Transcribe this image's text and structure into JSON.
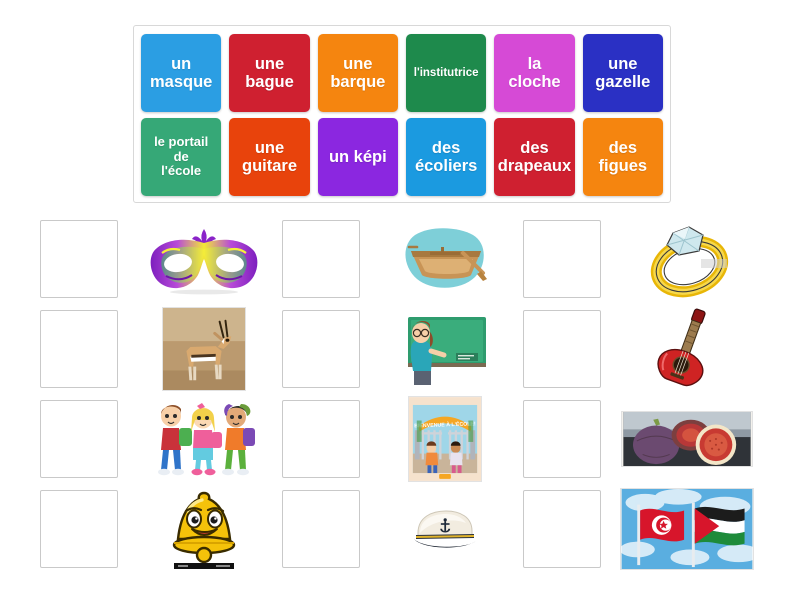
{
  "activity": {
    "type": "match-up drag and drop",
    "language": "French"
  },
  "tile_bank": {
    "rows": [
      [
        {
          "label": "un\nmasque",
          "color": "#2b9ee3",
          "size": "normal"
        },
        {
          "label": "une\nbague",
          "color": "#cf2030",
          "size": "normal"
        },
        {
          "label": "une\nbarque",
          "color": "#f5850f",
          "size": "normal"
        },
        {
          "label": "l'institutrice",
          "color": "#1e8a4c",
          "size": "small"
        },
        {
          "label": "la\ncloche",
          "color": "#d64ad6",
          "size": "normal"
        },
        {
          "label": "une\ngazelle",
          "color": "#2a30c4",
          "size": "normal"
        }
      ],
      [
        {
          "label": "le portail\nde\nl'école",
          "color": "#36a877",
          "size": "xsmall"
        },
        {
          "label": "une\nguitare",
          "color": "#e8430c",
          "size": "normal"
        },
        {
          "label": "un képi",
          "color": "#8b27e0",
          "size": "normal"
        },
        {
          "label": "des\nécoliers",
          "color": "#1b9ae0",
          "size": "normal"
        },
        {
          "label": "des\ndrapeaux",
          "color": "#cf2030",
          "size": "normal"
        },
        {
          "label": "des\nfigues",
          "color": "#f5850f",
          "size": "normal"
        }
      ]
    ]
  },
  "answer_grid": {
    "dropzone_value": "",
    "cells": [
      {
        "picture": "carnival-mask-image",
        "dropzone": "dropzone-mask"
      },
      {
        "picture": "rowboat-image",
        "dropzone": "dropzone-barque"
      },
      {
        "picture": "diamond-ring-image",
        "dropzone": "dropzone-bague"
      },
      {
        "picture": "gazelle-photo",
        "dropzone": "dropzone-gazelle"
      },
      {
        "picture": "teacher-chalkboard-image",
        "dropzone": "dropzone-institutrice"
      },
      {
        "picture": "acoustic-guitar-image",
        "dropzone": "dropzone-guitare"
      },
      {
        "picture": "schoolchildren-image",
        "dropzone": "dropzone-ecoliers"
      },
      {
        "picture": "school-gate-book-image",
        "dropzone": "dropzone-portail"
      },
      {
        "picture": "figs-photo",
        "dropzone": "dropzone-figues"
      },
      {
        "picture": "bell-cartoon-image",
        "dropzone": "dropzone-cloche"
      },
      {
        "picture": "captain-cap-image",
        "dropzone": "dropzone-kepi"
      },
      {
        "picture": "flags-photo",
        "dropzone": "dropzone-drapeaux"
      }
    ]
  },
  "picture_captions": {
    "school_gate_book": "BIENVENUE À L'ÉCOLE",
    "flags": "Tunisia and Palestine flags"
  },
  "colors": {
    "page_background": "#ffffff",
    "bank_border": "#d8d8d8",
    "dropzone_border": "#c9c9c9"
  }
}
